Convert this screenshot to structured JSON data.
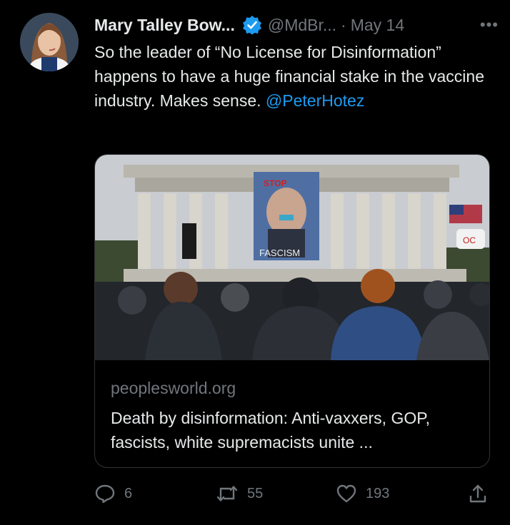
{
  "tweet": {
    "author_name": "Mary Talley Bow...",
    "handle": "@MdBr...",
    "separator": "·",
    "date": "May 14",
    "more_label": "•••",
    "text_before_mention": "So the leader of “No License for Disinformation” happens to have a huge financial stake in the vaccine industry.  Makes sense. ",
    "mention": "@PeterHotez"
  },
  "card": {
    "image_sign_top": "STOP",
    "image_sign_bottom": "FASCISM",
    "image_flag_text": "OC",
    "domain": "peoplesworld.org",
    "title": "Death by disinformation: Anti-vaxxers, GOP, fascists, white supremacists unite ..."
  },
  "actions": {
    "replies": "6",
    "retweets": "55",
    "likes": "193"
  },
  "colors": {
    "background": "#000000",
    "text": "#e7e9ea",
    "secondary": "#71767b",
    "accent": "#1d9bf0",
    "border": "#2f3336"
  }
}
